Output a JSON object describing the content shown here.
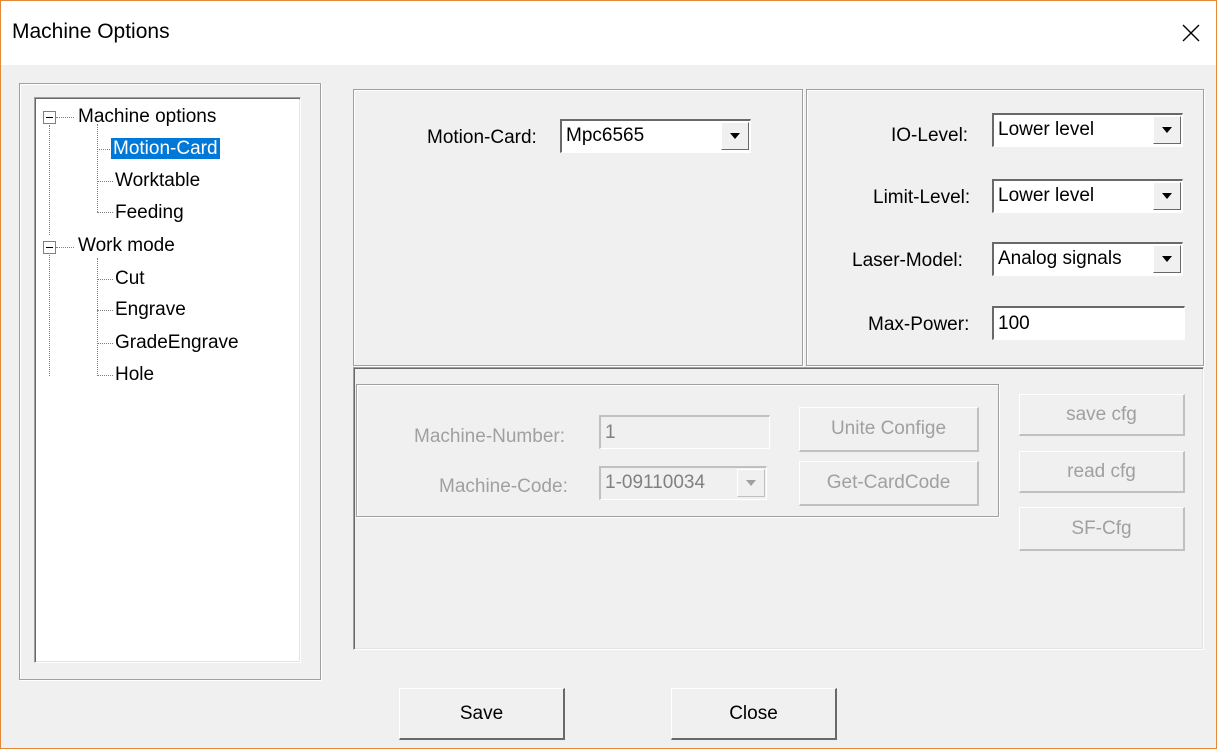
{
  "window": {
    "title": "Machine Options"
  },
  "tree": {
    "machine_options": "Machine options",
    "motion_card": "Motion-Card",
    "worktable": "Worktable",
    "feeding": "Feeding",
    "work_mode": "Work mode",
    "cut": "Cut",
    "engrave": "Engrave",
    "grade_engrave": "GradeEngrave",
    "hole": "Hole"
  },
  "motion": {
    "label": "Motion-Card:",
    "value": "Mpc6565"
  },
  "io": {
    "io_level_label": "IO-Level:",
    "io_level_value": "Lower level",
    "limit_level_label": "Limit-Level:",
    "limit_level_value": "Lower level",
    "laser_model_label": "Laser-Model:",
    "laser_model_value": "Analog signals",
    "max_power_label": "Max-Power:",
    "max_power_value": "100"
  },
  "machine": {
    "number_label": "Machine-Number:",
    "number_value": "1",
    "code_label": "Machine-Code:",
    "code_value": "1-09110034",
    "unite_config": "Unite Confige",
    "get_card_code": "Get-CardCode"
  },
  "cfg": {
    "save": "save cfg",
    "read": "read cfg",
    "sf": "SF-Cfg"
  },
  "footer": {
    "save": "Save",
    "close": "Close"
  }
}
